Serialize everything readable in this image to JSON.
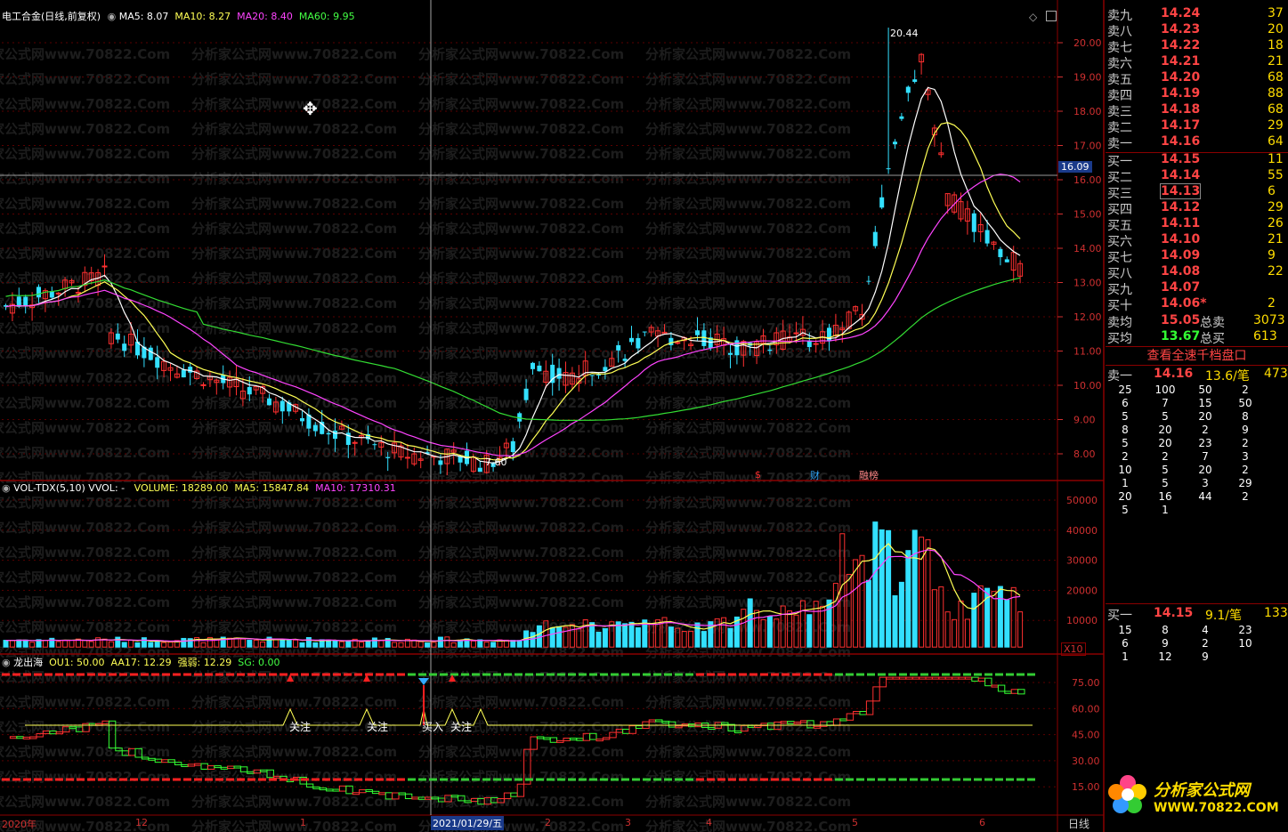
{
  "main_panel": {
    "title": "电工合金(日线,前复权)",
    "indicators": [
      {
        "label": "MA5: 8.07",
        "color": "#ffffff"
      },
      {
        "label": "MA10: 8.27",
        "color": "#ffff55"
      },
      {
        "label": "MA20: 8.40",
        "color": "#ff44ff"
      },
      {
        "label": "MA60: 9.95",
        "color": "#44ff44"
      }
    ],
    "price_axis": [
      "20.00",
      "19.00",
      "18.00",
      "17.00",
      "16.00",
      "15.00",
      "14.00",
      "13.00",
      "12.00",
      "11.00",
      "10.00",
      "9.00",
      "8.00"
    ],
    "crosshair_price": "16.09",
    "high_label": "20.44",
    "low_label": "7.60",
    "markers": [
      {
        "text": "$",
        "color": "#ff3030"
      },
      {
        "text": "财",
        "color": "#33aaff"
      },
      {
        "text": "融榜",
        "color": "#ff8888"
      }
    ]
  },
  "volume_panel": {
    "title": "VOL-TDX(5,10)",
    "vvol": "VVOL: -",
    "volume": "VOLUME: 18289.00",
    "ma5": "MA5: 15847.84",
    "ma10": "MA10: 17310.31",
    "axis": [
      "50000",
      "40000",
      "30000",
      "20000",
      "10000"
    ],
    "unit": "X10"
  },
  "indicator_panel": {
    "title": "龙出海",
    "ou1": "OU1: 50.00",
    "aa17": "AA17: 12.29",
    "qiangruo": "强弱: 12.29",
    "sg": "SG: 0.00",
    "axis": [
      "75.00",
      "60.00",
      "45.00",
      "30.00",
      "15.00"
    ],
    "labels": [
      "关注",
      "关注",
      "买入",
      "关注"
    ]
  },
  "date_bar": {
    "cursor_date": "2021/01/29/五",
    "ticks": [
      "2020年",
      "12",
      "1",
      "2",
      "3",
      "4",
      "5",
      "6"
    ],
    "period_button": "日线"
  },
  "order_book": {
    "asks": [
      {
        "label": "卖九",
        "price": "14.24",
        "vol": "37"
      },
      {
        "label": "卖八",
        "price": "14.23",
        "vol": "20"
      },
      {
        "label": "卖七",
        "price": "14.22",
        "vol": "18"
      },
      {
        "label": "卖六",
        "price": "14.21",
        "vol": "21"
      },
      {
        "label": "卖五",
        "price": "14.20",
        "vol": "68"
      },
      {
        "label": "卖四",
        "price": "14.19",
        "vol": "88"
      },
      {
        "label": "卖三",
        "price": "14.18",
        "vol": "68"
      },
      {
        "label": "卖二",
        "price": "14.17",
        "vol": "29"
      },
      {
        "label": "卖一",
        "price": "14.16",
        "vol": "64"
      }
    ],
    "bids": [
      {
        "label": "买一",
        "price": "14.15",
        "vol": "11"
      },
      {
        "label": "买二",
        "price": "14.14",
        "vol": "55"
      },
      {
        "label": "买三",
        "price": "14.13",
        "vol": "6"
      },
      {
        "label": "买四",
        "price": "14.12",
        "vol": "29"
      },
      {
        "label": "买五",
        "price": "14.11",
        "vol": "26"
      },
      {
        "label": "买六",
        "price": "14.10",
        "vol": "21"
      },
      {
        "label": "买七",
        "price": "14.09",
        "vol": "9"
      },
      {
        "label": "买八",
        "price": "14.08",
        "vol": "22"
      },
      {
        "label": "买九",
        "price": "14.07",
        "vol": ""
      },
      {
        "label": "买十",
        "price": "14.06*",
        "vol": "2"
      }
    ],
    "avg_sell_label": "卖均",
    "avg_sell": "15.05",
    "total_sell_label": "总卖",
    "total_sell": "3073",
    "avg_buy_label": "买均",
    "avg_buy": "13.67",
    "total_buy_label": "总买",
    "total_buy": "613",
    "full_depth_button": "查看全速千档盘口",
    "sell1": {
      "label": "卖一",
      "price": "14.16",
      "per": "13.6/笔",
      "total": "473"
    },
    "sell1_queue": [
      [
        "25",
        "100",
        "50",
        "2"
      ],
      [
        "6",
        "7",
        "15",
        "50"
      ],
      [
        "5",
        "5",
        "20",
        "8"
      ],
      [
        "8",
        "20",
        "2",
        "9"
      ],
      [
        "5",
        "20",
        "23",
        "2"
      ],
      [
        "2",
        "2",
        "7",
        "3"
      ],
      [
        "10",
        "5",
        "20",
        "2"
      ],
      [
        "1",
        "5",
        "3",
        "29"
      ],
      [
        "20",
        "16",
        "44",
        "2"
      ],
      [
        "5",
        "1",
        "",
        ""
      ]
    ],
    "buy1": {
      "label": "买一",
      "price": "14.15",
      "per": "9.1/笔",
      "total": "133"
    },
    "buy1_queue": [
      [
        "15",
        "8",
        "4",
        "23"
      ],
      [
        "6",
        "9",
        "2",
        "10"
      ],
      [
        "1",
        "12",
        "9",
        ""
      ]
    ]
  },
  "logo": {
    "name": "分析家公式网",
    "url": "WWW.70822.COM"
  },
  "watermark": "分析家公式网www.70822.Com"
}
